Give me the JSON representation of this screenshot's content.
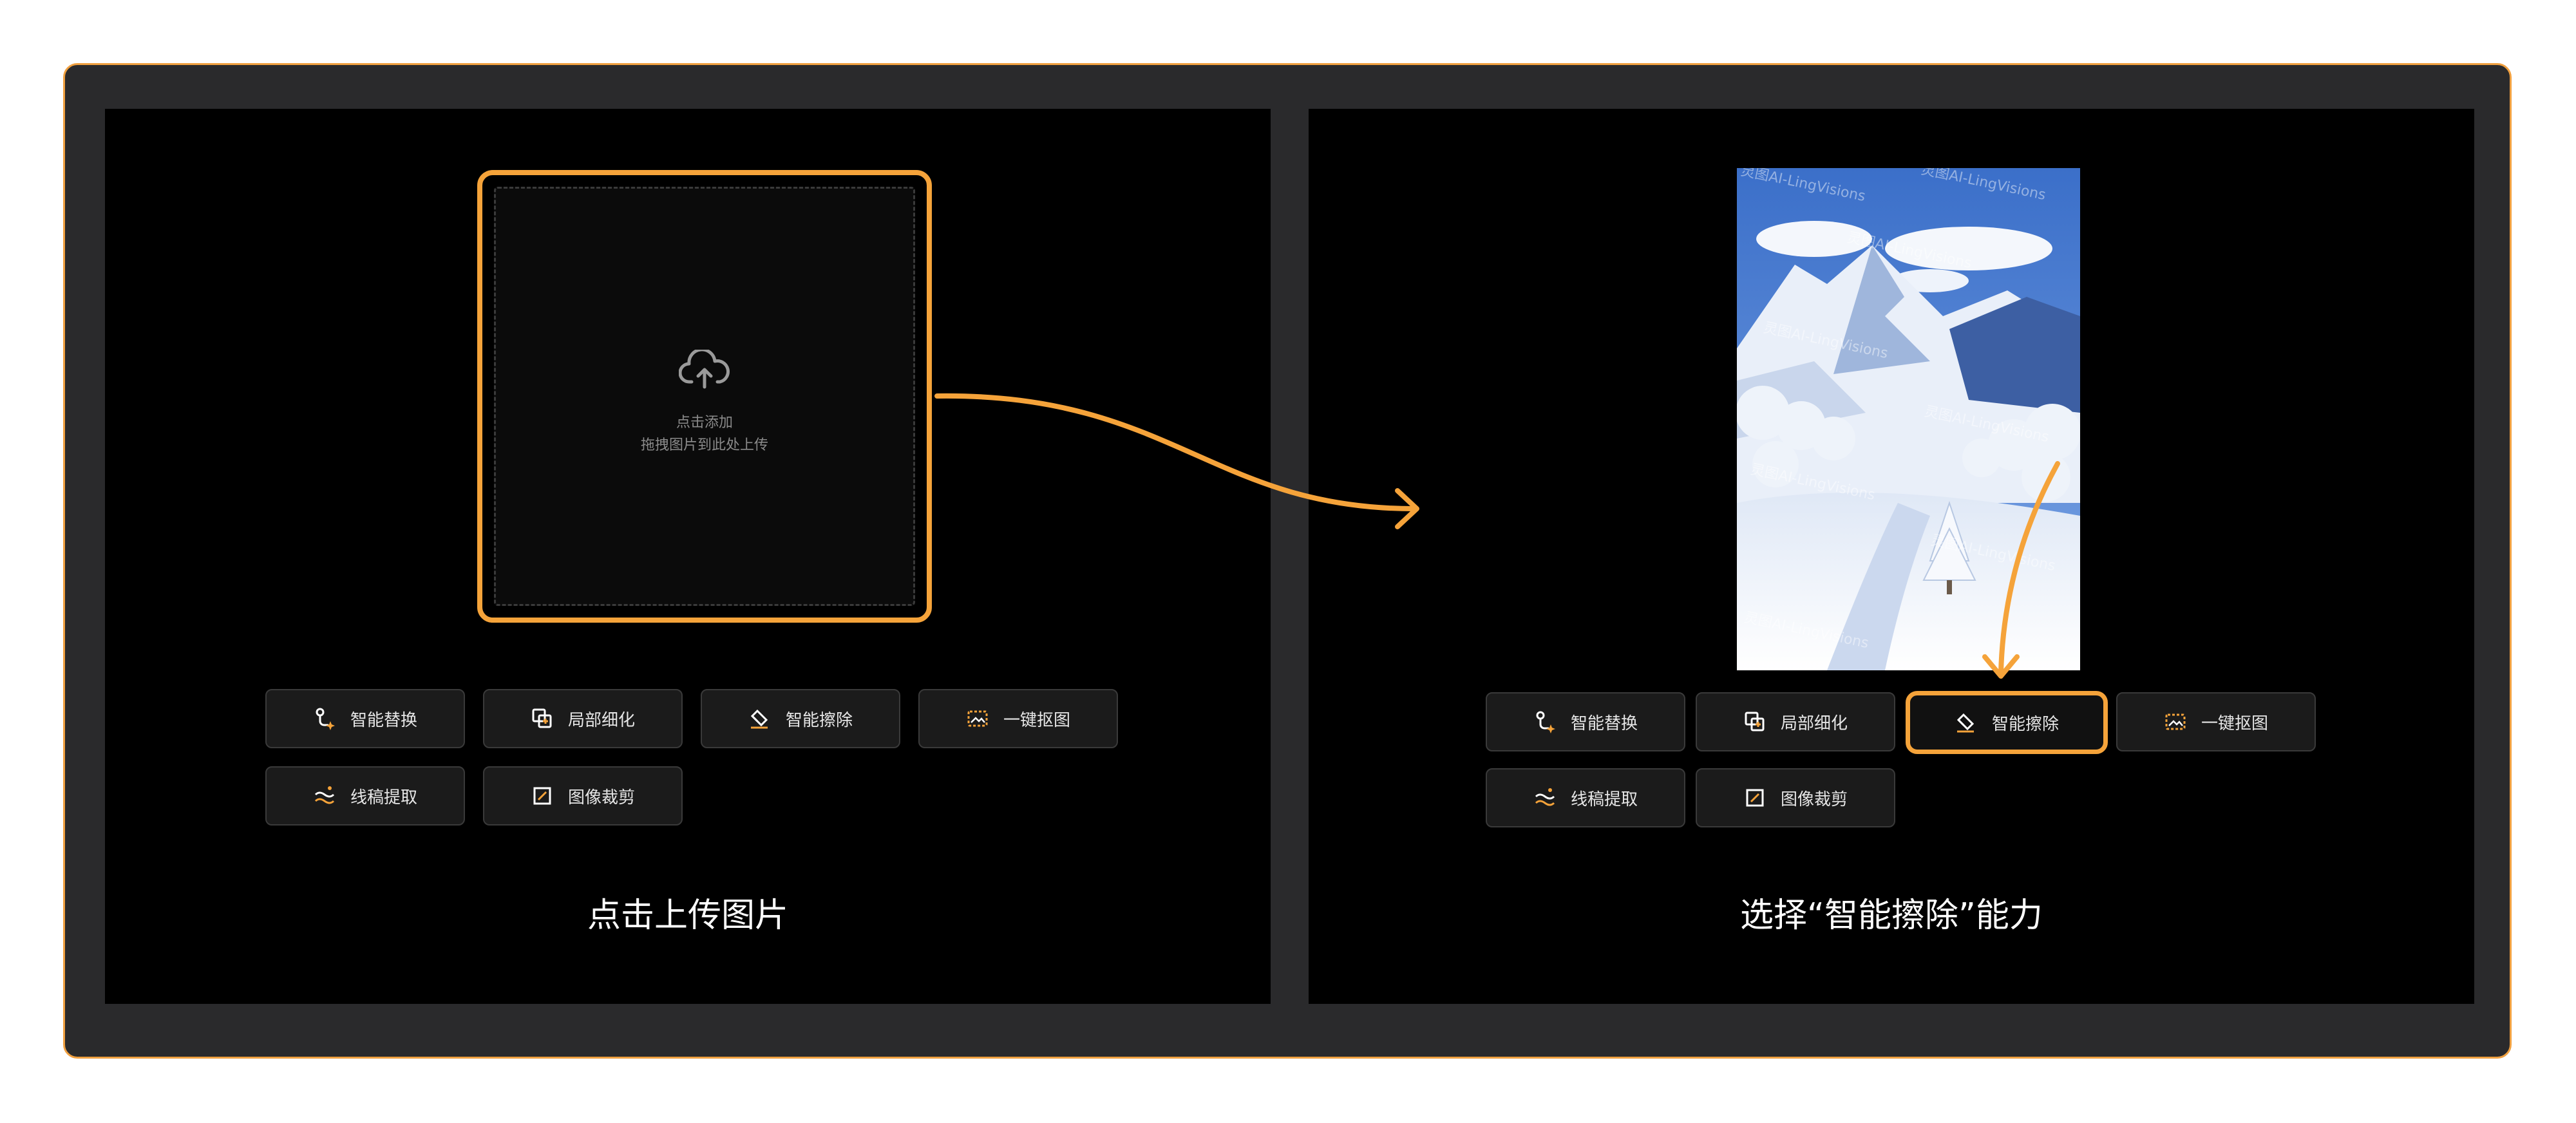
{
  "left_panel": {
    "upload": {
      "line1": "点击添加",
      "line2": "拖拽图片到此处上传"
    },
    "caption": "点击上传图片"
  },
  "right_panel": {
    "caption": "选择“智能擦除”能力",
    "watermark": "灵图AI-LingVisions"
  },
  "tools": [
    {
      "label": "智能替换",
      "icon": "smart-replace-icon"
    },
    {
      "label": "局部细化",
      "icon": "local-refine-icon"
    },
    {
      "label": "智能擦除",
      "icon": "smart-erase-icon"
    },
    {
      "label": "一键抠图",
      "icon": "cutout-icon"
    },
    {
      "label": "线稿提取",
      "icon": "line-extract-icon"
    },
    {
      "label": "图像裁剪",
      "icon": "crop-icon"
    }
  ],
  "active_tool_right": "智能擦除",
  "colors": {
    "accent": "#f5a33a",
    "frame": "#2a2a2c",
    "panel": "#000000",
    "button_bg": "#1b1b1b"
  }
}
